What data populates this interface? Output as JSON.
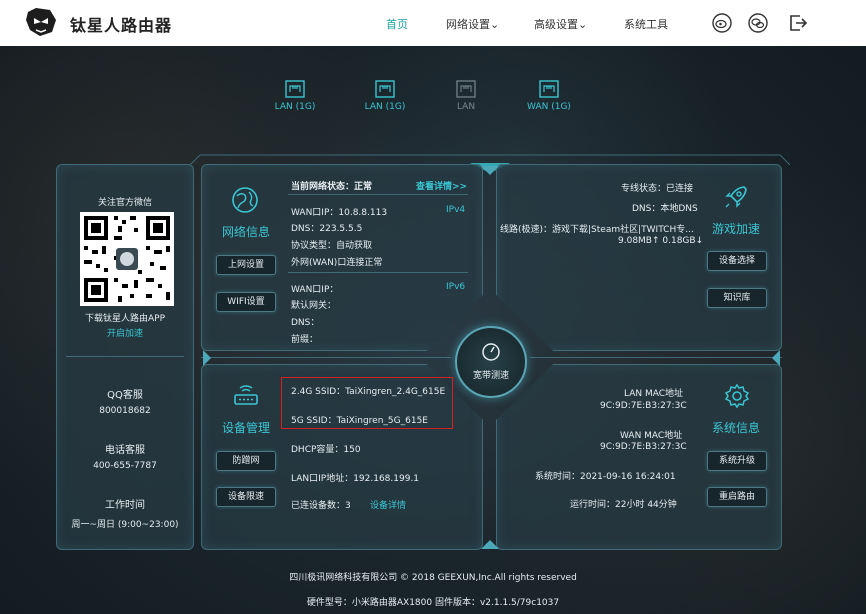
{
  "header": {
    "brand": "钛星人路由器",
    "nav": [
      "首页",
      "网络设置",
      "高级设置",
      "系统工具"
    ]
  },
  "ports": [
    {
      "label": "LAN (1G)",
      "active": true
    },
    {
      "label": "LAN (1G)",
      "active": true
    },
    {
      "label": "LAN",
      "active": false
    },
    {
      "label": "WAN (1G)",
      "active": true
    }
  ],
  "left": {
    "wechat_title": "关注官方微信",
    "app_text": "下载钛星人路由APP",
    "app_link": "开启加速",
    "qq_title": "QQ客服",
    "qq_value": "800018682",
    "phone_title": "电话客服",
    "phone_value": "400-655-7787",
    "hours_title": "工作时间",
    "hours_value": "周一~周日 (9:00~23:00)"
  },
  "network": {
    "title": "网络信息",
    "status_label": "当前网络状态：",
    "status_value": "正常",
    "details_link": "查看详情>>",
    "wan_ip_v4": "WAN口IP：10.8.8.113",
    "ipv4_tag": "IPv4",
    "dns": "DNS：223.5.5.5",
    "protocol": "协议类型：自动获取",
    "wan_status": "外网(WAN)口连接正常",
    "wan_ip_v6": "WAN口IP：",
    "ipv6_tag": "IPv6",
    "gateway": "默认网关：",
    "dns6": "DNS：",
    "prefix": "前缀：",
    "btn_internet": "上网设置",
    "btn_wifi": "WIFI设置"
  },
  "game": {
    "title": "游戏加速",
    "line_status": "专线状态：已连接",
    "dns_mode": "DNS：本地DNS",
    "route": "线路(极速)：游戏下载|Steam社区|TWITCH专...",
    "traffic": "9.08MB↑  0.18GB↓",
    "btn_device": "设备选择",
    "btn_knowledge": "知识库"
  },
  "center": {
    "label": "宽带测速"
  },
  "devices": {
    "title": "设备管理",
    "ssid_24": "2.4G SSID：TaiXingren_2.4G_615E",
    "ssid_5": "5G SSID：TaiXingren_5G_615E",
    "dhcp": "DHCP容量：150",
    "lan_ip": "LAN口IP地址：192.168.199.1",
    "connected_label": "已连设备数：3",
    "connected_link": "设备详情",
    "btn_firewall": "防蹭网",
    "btn_limit": "设备限速"
  },
  "system": {
    "title": "系统信息",
    "lan_mac_label": "LAN MAC地址",
    "lan_mac": "9C:9D:7E:B3:27:3C",
    "wan_mac_label": "WAN MAC地址",
    "wan_mac": "9C:9D:7E:B3:27:3C",
    "time": "系统时间：2021-09-16 16:24:01",
    "uptime": "运行时间：22小时 44分钟",
    "btn_upgrade": "系统升级",
    "btn_reboot": "重启路由"
  },
  "footer": {
    "copyright": "四川极讯网络科技有限公司 © 2018 GEEXUN,Inc.All rights reserved",
    "version": "硬件型号：小米路由器AX1800  固件版本：v2.1.1.5/79c1037"
  },
  "colors": {
    "accent": "#3ac7d3",
    "panel_border": "#3f6a76",
    "highlight": "#d42020"
  }
}
